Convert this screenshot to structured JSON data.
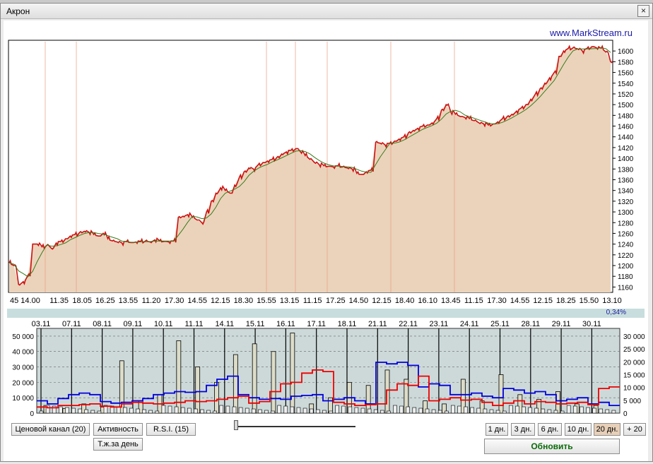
{
  "window": {
    "title": "Акрон",
    "close_glyph": "×"
  },
  "site": "www.MarkStream.ru",
  "price_chart": {
    "y_ticks": [
      1160,
      1180,
      1200,
      1220,
      1240,
      1260,
      1280,
      1300,
      1320,
      1340,
      1360,
      1380,
      1400,
      1420,
      1440,
      1460,
      1480,
      1500,
      1520,
      1540,
      1560,
      1580,
      1600
    ],
    "x_labels": [
      "45 14.00",
      "11.35",
      "18.05",
      "16.25",
      "13.55",
      "11.20",
      "17.30",
      "14.55",
      "12.15",
      "18.30",
      "15.55",
      "13.15",
      "11.15",
      "17.25",
      "14.50",
      "12.15",
      "18.40",
      "16.10",
      "13.45",
      "11.15",
      "17.30",
      "14.55",
      "12.15",
      "18.25",
      "15.50",
      "13.10"
    ]
  },
  "chart_data": [
    {
      "type": "area",
      "title": "",
      "ylim": [
        1150,
        1620
      ],
      "grid": false,
      "series": [
        {
          "values": [
            1205,
            1200,
            1165,
            1170,
            1182,
            1240,
            1240,
            1235,
            1238,
            1232,
            1242,
            1245,
            1250,
            1255,
            1258,
            1262,
            1264,
            1262,
            1258,
            1255,
            1260,
            1250,
            1246,
            1244,
            1242,
            1245,
            1243,
            1244,
            1245,
            1246,
            1244,
            1248,
            1246,
            1245,
            1244,
            1246,
            1290,
            1292,
            1295,
            1290,
            1285,
            1280,
            1300,
            1320,
            1335,
            1345,
            1340,
            1335,
            1350,
            1365,
            1375,
            1382,
            1380,
            1388,
            1392,
            1395,
            1398,
            1402,
            1408,
            1412,
            1415,
            1418,
            1412,
            1405,
            1398,
            1392,
            1388,
            1386,
            1385,
            1384,
            1386,
            1384,
            1382,
            1380,
            1372,
            1370,
            1375,
            1378,
            1430,
            1428,
            1425,
            1428,
            1432,
            1436,
            1440,
            1448,
            1452,
            1456,
            1460,
            1462,
            1466,
            1474,
            1490,
            1500,
            1486,
            1482,
            1478,
            1476,
            1474,
            1470,
            1466,
            1464,
            1462,
            1464,
            1468,
            1474,
            1478,
            1482,
            1488,
            1494,
            1500,
            1510,
            1520,
            1530,
            1540,
            1550,
            1560,
            1590,
            1600,
            1605,
            1606,
            1604,
            1600,
            1605,
            1608,
            1606,
            1605,
            1598,
            1580
          ]
        }
      ]
    },
    {
      "type": "line",
      "title": "",
      "x_labels": [
        "03.11",
        "07.11",
        "08.11",
        "09.11",
        "10.11",
        "11.11",
        "14.11",
        "15.11",
        "16.11",
        "17.11",
        "18.11",
        "21.11",
        "22.11",
        "23.11",
        "24.11",
        "25.11",
        "28.11",
        "29.11",
        "30.11"
      ],
      "y_left_ticks": [
        0,
        10000,
        20000,
        30000,
        40000,
        50000
      ],
      "y_left_tick_labels": [
        "0",
        "10 000",
        "20 000",
        "30 000",
        "40 000",
        "50 000"
      ],
      "y_right_ticks": [
        0,
        5000,
        10000,
        15000,
        20000,
        25000,
        30000
      ],
      "y_right_tick_labels": [
        "0",
        "5 000",
        "10 000",
        "15 000",
        "20 000",
        "25 000",
        "30 000"
      ],
      "ylim_left": [
        0,
        55000
      ],
      "ylim_right": [
        0,
        33000
      ],
      "series": [
        {
          "color": "#0000dd",
          "values": [
            8000,
            6000,
            9500,
            12000,
            13000,
            12000,
            7500,
            6500,
            7000,
            8000,
            9500,
            12000,
            13000,
            14000,
            13500,
            14000,
            18000,
            22000,
            24000,
            12000,
            10000,
            9000,
            9500,
            9000,
            11000,
            11500,
            12000,
            8000,
            9000,
            10000,
            8000,
            6000,
            33000,
            32000,
            33000,
            31000,
            17000,
            19000,
            18000,
            12000,
            12000,
            13000,
            11000,
            10000,
            16000,
            15000,
            13000,
            14000,
            12000,
            8000,
            9000,
            10000,
            6000,
            7000,
            5000
          ]
        },
        {
          "color": "#ee0000",
          "values": [
            4000,
            3500,
            5000,
            5000,
            5500,
            6000,
            4500,
            4000,
            6000,
            7000,
            6500,
            6000,
            6500,
            7000,
            8000,
            7500,
            8000,
            9000,
            10000,
            11000,
            6500,
            7500,
            14000,
            19000,
            20000,
            26000,
            28000,
            27000,
            7000,
            6000,
            5000,
            5500,
            6000,
            15000,
            19000,
            18000,
            24000,
            8000,
            9000,
            10000,
            8500,
            9000,
            7000,
            5000,
            6500,
            8000,
            6000,
            7500,
            7000,
            6000,
            6500,
            7000,
            5500,
            16000,
            17000
          ]
        }
      ],
      "volume_bars": [
        5000,
        3000,
        6000,
        4000,
        34000,
        8000,
        12000,
        47000,
        30000,
        20000,
        38000,
        45000,
        40000,
        52000,
        6000,
        10000,
        20000,
        18000,
        28000,
        22000,
        8000,
        6000,
        22000,
        8000,
        25000,
        12000,
        9000,
        14000,
        6000,
        5000
      ]
    }
  ],
  "buttons": {
    "price_channel": "Ценовой канал (20)",
    "activity": "Активность",
    "rsi": "R.S.I.  (15)",
    "daily_volume": "Т.ж.за день",
    "period_1": "1 дн.",
    "period_3": "3 дн.",
    "period_6": "6 дн.",
    "period_10": "10 дн.",
    "period_20": "20 дн.",
    "period_more": "+ 20",
    "refresh": "Обновить"
  },
  "performance": "0,34%",
  "colors": {
    "price_fill": "#ebd3bb",
    "price_line": "#cc1111",
    "ma_line": "#3a7a1a",
    "lower_bg": "#cdd9d9",
    "accent_blue": "#1a1aa6"
  }
}
